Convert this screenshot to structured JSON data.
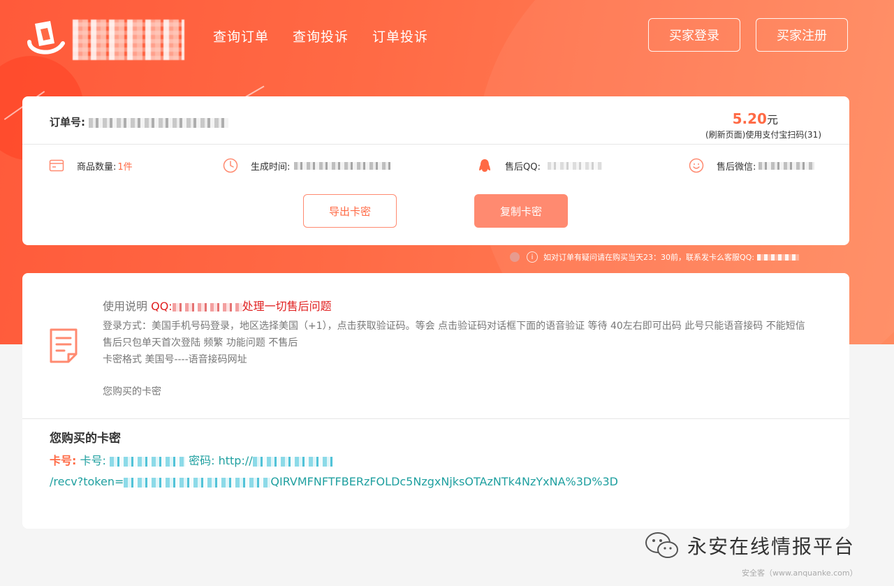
{
  "header": {
    "nav": [
      "查询订单",
      "查询投诉",
      "订单投诉"
    ],
    "login_label": "买家登录",
    "register_label": "买家注册"
  },
  "order": {
    "order_no_label": "订单号:",
    "price_value": "5.20",
    "price_unit": "元",
    "price_note": "(刷新页面)使用支付宝扫码(31)",
    "quantity_label": "商品数量:",
    "quantity_value": "1件",
    "created_label": "生成时间:",
    "qq_label": "售后QQ:",
    "wechat_label": "售后微信:",
    "export_label": "导出卡密",
    "copy_label": "复制卡密"
  },
  "tip": {
    "text": "如对订单有疑问请在购买当天23：30前，联系发卡么客服QQ:"
  },
  "instructions": {
    "title_prefix": "使用说明 ",
    "title_qq": "QQ:",
    "title_suffix": "处理一切售后问题",
    "line1": "登录方式：美国手机号码登录，地区选择美国（+1），点击获取验证码。等会 点击验证码对话框下面的语音验证 等待 40左右即可出码  此号只能语音接码 不能短信",
    "line2": "售后只包单天首次登陆 频繁 功能问题 不售后",
    "line3": "卡密格式 美国号----语音接码网址",
    "line4": "您购买的卡密"
  },
  "purchased": {
    "title": "您购买的卡密",
    "card_no_label": "卡号:",
    "card_no_inner": "卡号:",
    "password_label": "密码:",
    "url_prefix": "http://",
    "token_path": "/recv?token=",
    "token_tail": "QIRVMFNFTFBERzFOLDc5NzgxNjksOTAzNTk4NzYxNA%3D%3D"
  },
  "watermark": {
    "text": "永安在线情报平台",
    "sub": "安全客（www.anquanke.com）"
  },
  "colors": {
    "accent": "#ff6a45",
    "button_fill": "#ff8a70",
    "link_teal": "#20a0a0",
    "alert_red": "#e02020"
  }
}
